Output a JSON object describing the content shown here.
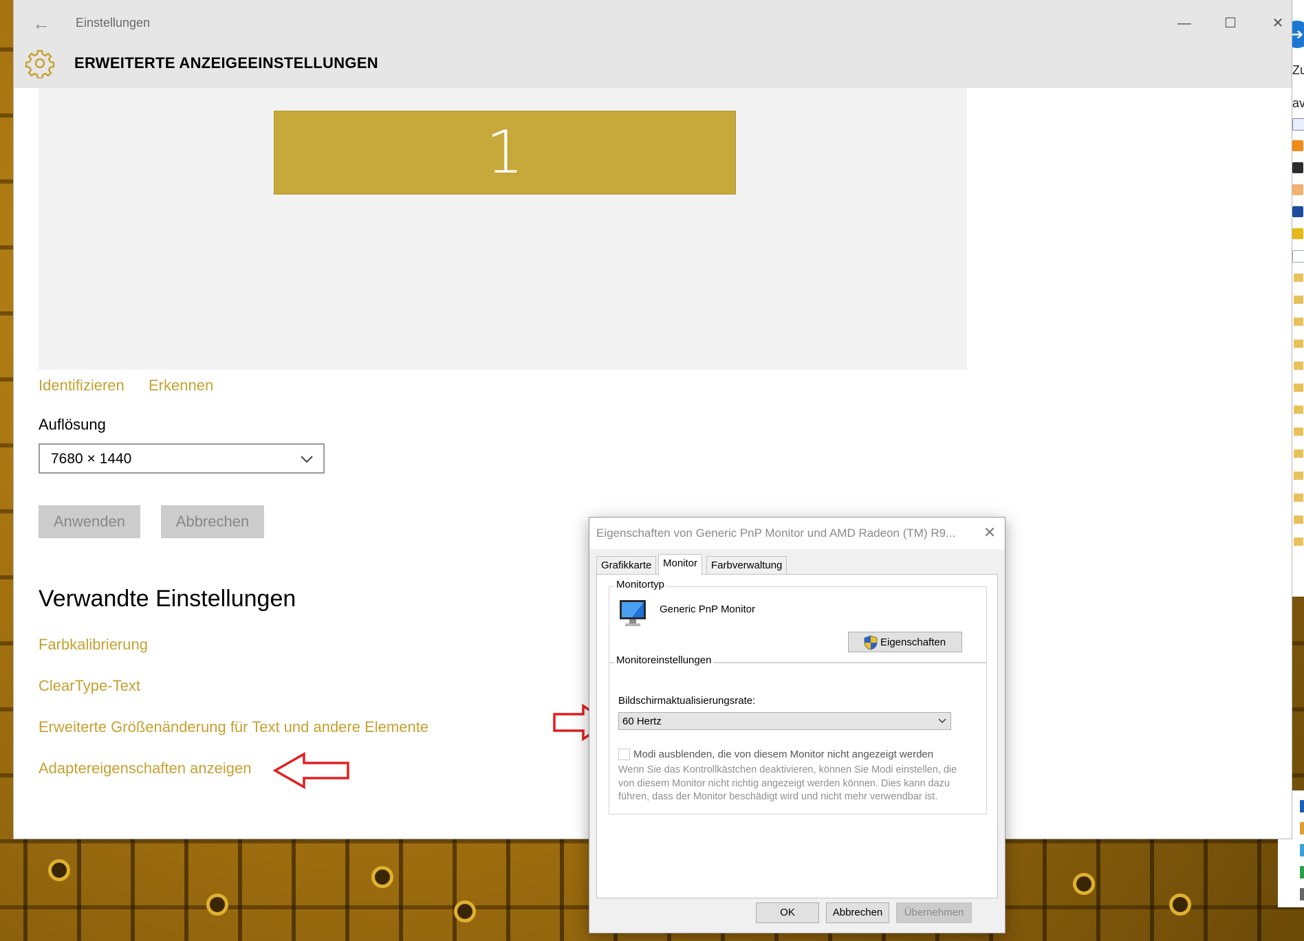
{
  "settings": {
    "window_title": "Einstellungen",
    "page_heading": "ERWEITERTE ANZEIGEEINSTELLUNGEN",
    "monitor_number": "1",
    "links": {
      "identify": "Identifizieren",
      "detect": "Erkennen"
    },
    "resolution": {
      "label": "Auflösung",
      "value": "7680 × 1440"
    },
    "buttons": {
      "apply": "Anwenden",
      "cancel": "Abbrechen"
    },
    "related": {
      "heading": "Verwandte Einstellungen",
      "items": [
        "Farbkalibrierung",
        "ClearType-Text",
        "Erweiterte Größenänderung für Text und andere Elemente",
        "Adaptereigenschaften anzeigen"
      ]
    },
    "accent_color": "#c5a131"
  },
  "dialog": {
    "title": "Eigenschaften von Generic PnP Monitor und AMD Radeon (TM) R9...",
    "tabs": [
      "Grafikkarte",
      "Monitor",
      "Farbverwaltung"
    ],
    "active_tab": "Monitor",
    "monitor_type": {
      "group_title": "Monitortyp",
      "name": "Generic PnP Monitor",
      "properties_button": "Eigenschaften"
    },
    "monitor_settings": {
      "group_title": "Monitoreinstellungen",
      "refresh_label": "Bildschirmaktualisierungsrate:",
      "refresh_value": "60 Hertz",
      "hide_modes_label": "Modi ausblenden, die von diesem Monitor nicht angezeigt werden",
      "hide_modes_description": "Wenn Sie das Kontrollkästchen deaktivieren, können Sie Modi einstellen, die von diesem Monitor nicht richtig angezeigt werden können. Dies kann dazu führen, dass der Monitor beschädigt wird und nicht mehr verwendbar ist."
    },
    "buttons": {
      "ok": "OK",
      "cancel": "Abbrechen",
      "apply": "Übernehmen"
    }
  },
  "background_window": {
    "text_1": "Zu",
    "text_2": "ave"
  },
  "annotation_color": "#e02020"
}
